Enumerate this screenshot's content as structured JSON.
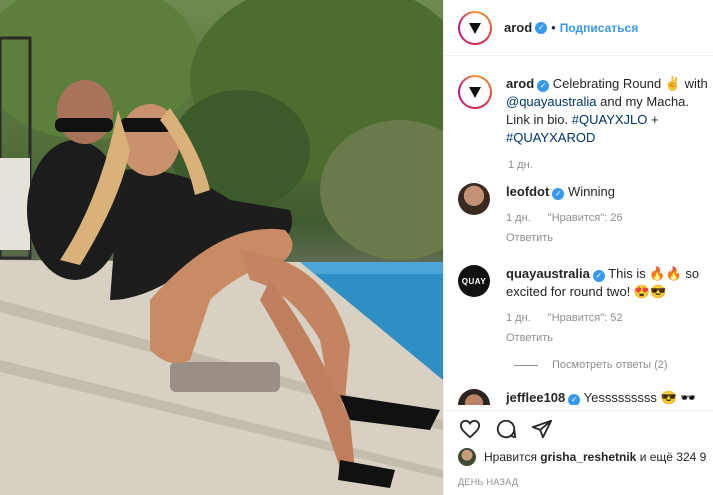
{
  "post": {
    "image_alt": "Photo of couple posing by pool wearing Quay sunglasses"
  },
  "header": {
    "username": "arod",
    "separator": "•",
    "follow_label": "Подписаться"
  },
  "caption": {
    "username": "arod",
    "text_1": "Celebrating Round ✌️ with ",
    "mention": "@quayaustralia",
    "text_2": " and my Macha. Link in bio. ",
    "hashtag_1": "#QUAYXJLO",
    "plus": " + ",
    "hashtag_2": "#QUAYXAROD",
    "time": "1 дн."
  },
  "comments": [
    {
      "username": "leofdot",
      "text": "Winning",
      "time": "1 дн.",
      "likes": "\"Нравится\": 26",
      "reply": "Ответить",
      "avatar_label": ""
    },
    {
      "username": "quayaustralia",
      "text": "This is 🔥🔥 so excited for round two! 😍😎",
      "time": "1 дн.",
      "likes": "\"Нравится\": 52",
      "reply": "Ответить",
      "avatar_label": "QUAY",
      "view_replies": "Посмотреть ответы (2)"
    },
    {
      "username": "jefflee108",
      "text": "Yesssssssss 😎 🕶️",
      "avatar_label": ""
    }
  ],
  "actions": {
    "like": "heart-icon",
    "comment": "comment-icon",
    "share": "share-icon"
  },
  "likes": {
    "prefix": "Нравится",
    "user": "grisha_reshetnik",
    "suffix": "и ещё 324 9"
  },
  "timestamp": "ДЕНЬ НАЗАД",
  "colors": {
    "accent": "#3897f0",
    "link": "#003569",
    "muted": "#8e8e8e"
  }
}
